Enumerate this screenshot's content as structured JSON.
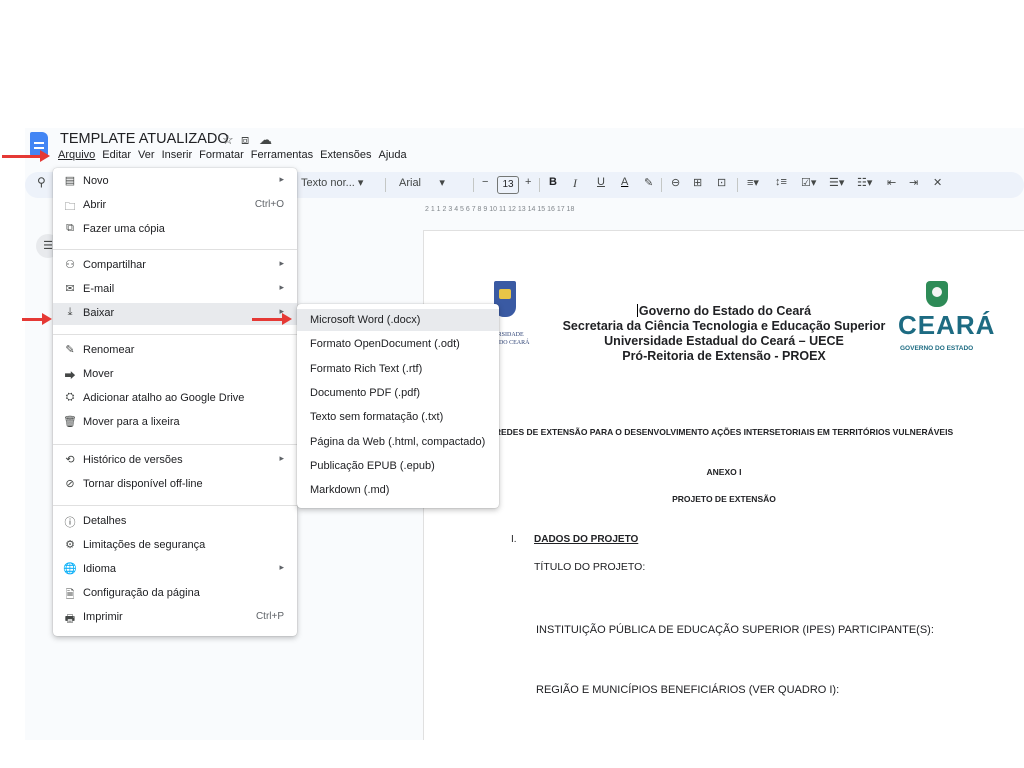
{
  "document": {
    "title": "TEMPLATE ATUALIZADO"
  },
  "menubar": {
    "items": [
      "Arquivo",
      "Editar",
      "Ver",
      "Inserir",
      "Formatar",
      "Ferramentas",
      "Extensões",
      "Ajuda"
    ],
    "active": "Arquivo"
  },
  "toolbar": {
    "style_select": "Texto nor...",
    "font_select": "Arial",
    "font_size": "13",
    "minus": "−",
    "plus": "+",
    "bold": "B",
    "italic": "I",
    "underline": "U",
    "text_color": "A"
  },
  "ruler": {
    "ticks": "2 1 1 2 3 4 5 6 7 8 9 10 11 12 13 14 15 16 17 18"
  },
  "file_menu": {
    "items": [
      {
        "label": "Novo",
        "icon": "new-doc-icon",
        "glyph": "▤",
        "submenu": true
      },
      {
        "label": "Abrir",
        "icon": "folder-icon",
        "glyph": "🗀",
        "shortcut": "Ctrl+O"
      },
      {
        "label": "Fazer uma cópia",
        "icon": "copy-icon",
        "glyph": "⧉"
      },
      {
        "label": "Compartilhar",
        "icon": "share-icon",
        "glyph": "⚇",
        "submenu": true
      },
      {
        "label": "E-mail",
        "icon": "email-icon",
        "glyph": "✉",
        "submenu": true
      },
      {
        "label": "Baixar",
        "icon": "download-icon",
        "glyph": "⤓",
        "submenu": true,
        "highlighted": true
      },
      {
        "label": "Renomear",
        "icon": "pencil-icon",
        "glyph": "✎"
      },
      {
        "label": "Mover",
        "icon": "move-folder-icon",
        "glyph": "⮕"
      },
      {
        "label": "Adicionar atalho ao Google Drive",
        "icon": "drive-shortcut-icon",
        "glyph": "⛭"
      },
      {
        "label": "Mover para a lixeira",
        "icon": "trash-icon",
        "glyph": "🗑"
      },
      {
        "label": "Histórico de versões",
        "icon": "history-icon",
        "glyph": "⟲",
        "submenu": true
      },
      {
        "label": "Tornar disponível off-line",
        "icon": "offline-icon",
        "glyph": "⊘"
      },
      {
        "label": "Detalhes",
        "icon": "info-icon",
        "glyph": "ⓘ"
      },
      {
        "label": "Limitações de segurança",
        "icon": "security-icon",
        "glyph": "⚙"
      },
      {
        "label": "Idioma",
        "icon": "globe-icon",
        "glyph": "🌐",
        "submenu": true
      },
      {
        "label": "Configuração da página",
        "icon": "page-setup-icon",
        "glyph": "🗎"
      },
      {
        "label": "Imprimir",
        "icon": "printer-icon",
        "glyph": "🖶",
        "shortcut": "Ctrl+P"
      }
    ]
  },
  "download_submenu": {
    "items": [
      {
        "label": "Microsoft Word (.docx)",
        "highlighted": true
      },
      {
        "label": "Formato OpenDocument (.odt)"
      },
      {
        "label": "Formato Rich Text (.rtf)"
      },
      {
        "label": "Documento PDF (.pdf)"
      },
      {
        "label": "Texto sem formatação (.txt)"
      },
      {
        "label": "Página da Web (.html, compactado)"
      },
      {
        "label": "Publicação EPUB (.epub)"
      },
      {
        "label": "Markdown (.md)"
      }
    ]
  },
  "page": {
    "header_lines": [
      "Governo do Estado do Ceará",
      "Secretaria da Ciência Tecnologia e Educação Superior",
      "Universidade Estadual do Ceará – UECE",
      "Pró-Reitoria de Extensão - PROEX"
    ],
    "left_logo_text": [
      "ERSIDADE",
      "L DO CEARÁ"
    ],
    "right_logo_word": "CEARÁ",
    "right_logo_sub": "GOVERNO DO ESTADO",
    "program_title": "REDES DE EXTENSÃO PARA O DESENVOLVIMENTO AÇÕES INTERSETORIAIS EM TERRITÓRIOS VULNERÁVEIS",
    "annex": "ANEXO I",
    "project_label": "PROJETO DE EXTENSÃO",
    "section_number": "I.",
    "section_title": "DADOS DO PROJETO",
    "fields": [
      "TÍTULO DO PROJETO:",
      "INSTITUIÇÃO PÚBLICA DE EDUCAÇÃO SUPERIOR (IPES) PARTICIPANTE(S):",
      "REGIÃO E MUNICÍPIOS BENEFICIÁRIOS (VER QUADRO I):"
    ]
  },
  "colors": {
    "accent": "#4285f4",
    "annotation_arrow": "#e53935",
    "menu_highlight": "#e8eaed",
    "toolbar_bg": "#edf2fa"
  }
}
